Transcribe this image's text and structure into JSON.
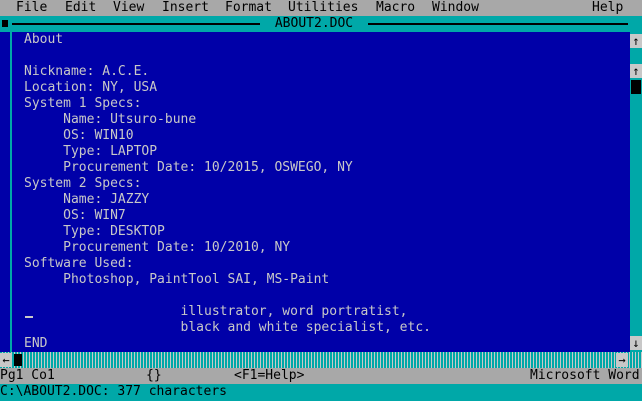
{
  "menu": {
    "items": [
      "File",
      "Edit",
      "View",
      "Insert",
      "Format",
      "Utilities",
      "Macro",
      "Window"
    ],
    "help": "Help"
  },
  "window": {
    "title": "ABOUT2.DOC"
  },
  "document": {
    "lines": [
      "About",
      "",
      "Nickname: A.C.E.",
      "Location: NY, USA",
      "System 1 Specs:",
      "     Name: Utsuro-bune",
      "     OS: WIN10",
      "     Type: LAPTOP",
      "     Procurement Date: 10/2015, OSWEGO, NY",
      "System 2 Specs:",
      "     Name: JAZZY",
      "     OS: WIN7",
      "     Type: DESKTOP",
      "     Procurement Date: 10/2010, NY",
      "Software Used:",
      "     Photoshop, PaintTool SAI, MS-Paint",
      "",
      "                    illustrator, word portratist,",
      "                    black and white specialist, etc.",
      "END"
    ]
  },
  "scrollbar": {
    "up_glyph": "↑",
    "down_glyph": "↓",
    "left_glyph": "←",
    "right_glyph": "→"
  },
  "status": {
    "position": "Pg1 Co1",
    "braces": "{}",
    "help_hint": "<F1=Help>",
    "app_name": "Microsoft Word"
  },
  "message": "C:\\ABOUT2.DOC: 377 characters"
}
